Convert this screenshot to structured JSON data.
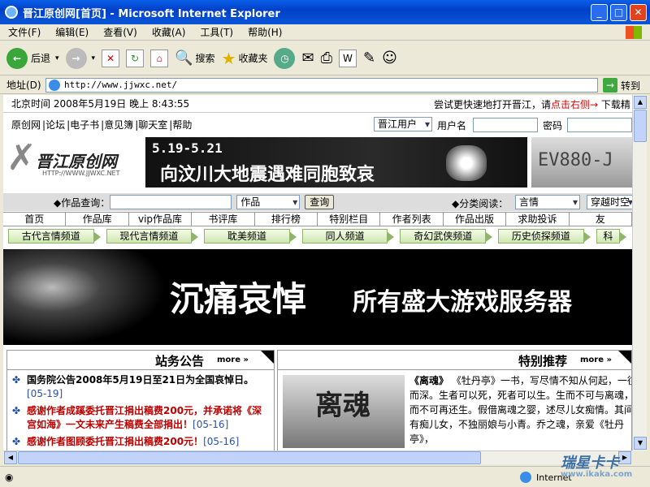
{
  "window": {
    "title": "晋江原创网[首页] - Microsoft Internet Explorer"
  },
  "menu": [
    "文件(F)",
    "编辑(E)",
    "查看(V)",
    "收藏(A)",
    "工具(T)",
    "帮助(H)"
  ],
  "toolbar": {
    "back": "后退",
    "search": "搜索",
    "favorites": "收藏夹"
  },
  "address": {
    "label": "地址(D)",
    "url": "http://www.jjwxc.net/",
    "go": "转到"
  },
  "page": {
    "clock": "北京时间 2008年5月19日 晚上 8:43:55",
    "tip_prefix": "尝试更快速地打开晋江，请",
    "tip_link": "点击右侧→",
    "tip_suffix": "下载精",
    "nav_links": [
      "原创网",
      "论坛",
      "电子书",
      "意见簿",
      "聊天室",
      "帮助"
    ],
    "user_type": "晋江用户",
    "username_label": "用户名",
    "password_label": "密码",
    "logo_name": "晋江原创网",
    "logo_url": "HTTP://WWW.JJWXC.NET",
    "banner_date": "5.19-5.21",
    "banner_slogan": "向汶川大地震遇难同胞致哀",
    "ad_text": "EV880-J",
    "search_label": "◆作品查询：",
    "search_type": "作品",
    "search_button": "查询",
    "classify_label": "◆分类阅读：",
    "classify_value": "言情",
    "classify_value2": "穿越时空",
    "main_nav": [
      "首页",
      "作品库",
      "vip作品库",
      "书评库",
      "排行榜",
      "特别栏目",
      "作者列表",
      "作品出版",
      "求助投诉",
      "友"
    ],
    "channels": [
      "古代言情频道",
      "现代言情频道",
      "耽美频道",
      "同人频道",
      "奇幻武侠频道",
      "历史侦探频道",
      "科"
    ],
    "mourn_title1": "沉痛哀悼",
    "mourn_title2": "所有盛大游戏服务器",
    "announce_title": "站务公告",
    "more": "more",
    "announcements": [
      {
        "text": "国务院公告2008年5月19日至21日为全国哀悼日。",
        "date": "[05-19]"
      },
      {
        "text": "感谢作者成蹊委托晋江捐出稿费200元，并承诺将《深宫如海》一文未来产生稿费全部捐出！",
        "date": "[05-16]"
      },
      {
        "text": "感谢作者图顾委托晋江捐出稿费200元！",
        "date": "[05-16]"
      }
    ],
    "rec_title": "特别推荐",
    "rec_img_text": "离魂",
    "rec_book": "《离魂》",
    "rec_desc": "《牡丹亭》一书，写尽情不知从何起，一往而深。生者可以死，死者可以生。生而不可与离魂，魂而不可再还生。假借离魂之婴，述尽儿女痴情。其间有有痴儿女，不独丽娘与小青。乔之魂，亲爱《牡丹亭》，"
  },
  "status": {
    "zone": "Internet"
  },
  "watermark": {
    "brand": "瑞星卡卡",
    "site": "www.ikaka.com"
  }
}
